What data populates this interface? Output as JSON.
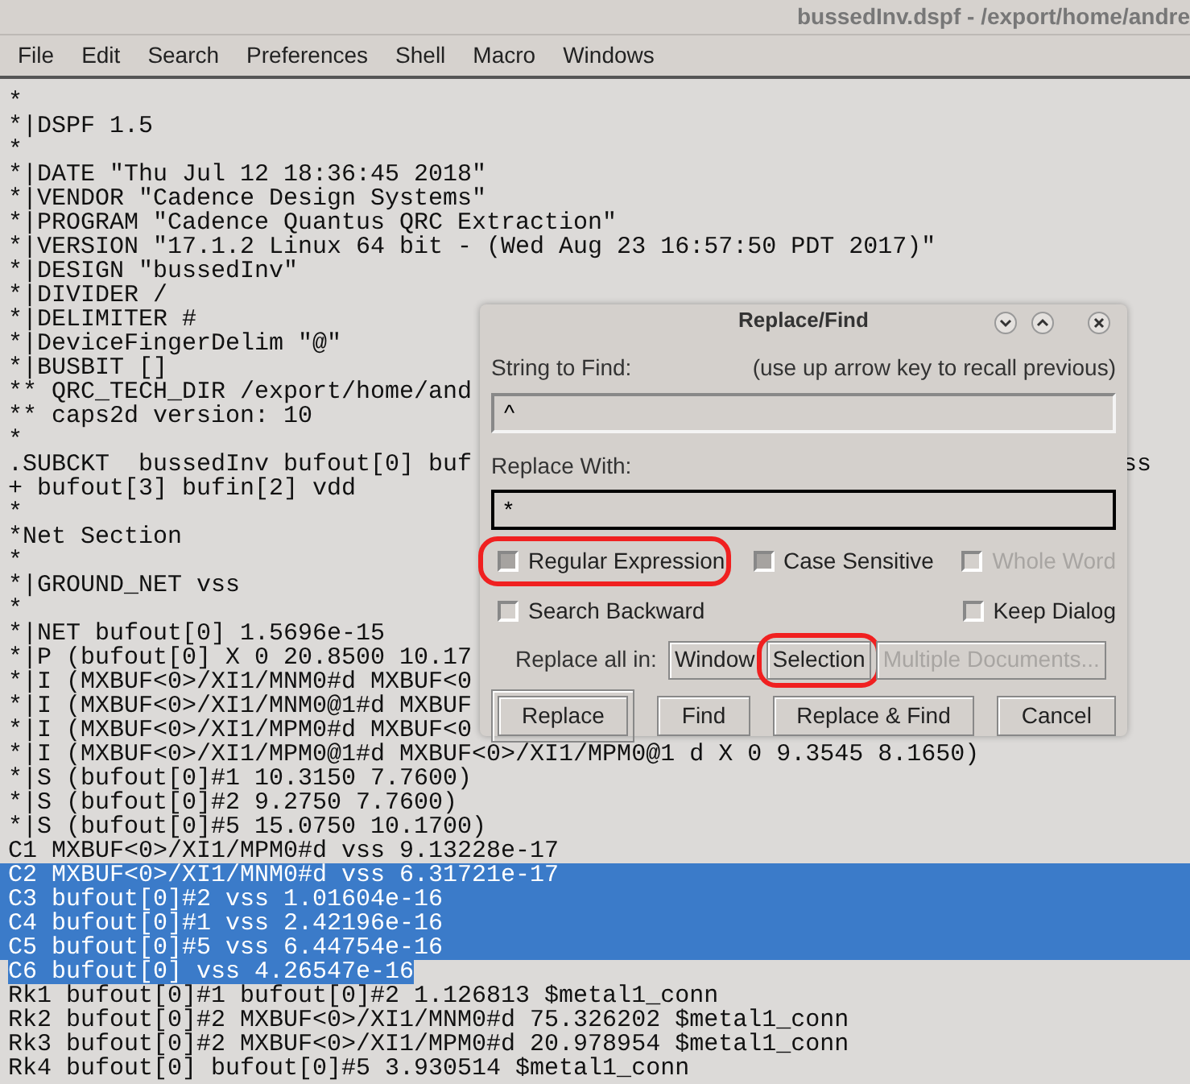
{
  "window": {
    "title": "bussedInv.dspf - /export/home/andre"
  },
  "menu": [
    "File",
    "Edit",
    "Search",
    "Preferences",
    "Shell",
    "Macro",
    "Windows"
  ],
  "editor": {
    "lines": [
      {
        "text": "*",
        "selected": false
      },
      {
        "text": "*|DSPF 1.5",
        "selected": false
      },
      {
        "text": "*",
        "selected": false
      },
      {
        "text": "*|DATE \"Thu Jul 12 18:36:45 2018\"",
        "selected": false
      },
      {
        "text": "*|VENDOR \"Cadence Design Systems\"",
        "selected": false
      },
      {
        "text": "*|PROGRAM \"Cadence Quantus QRC Extraction\"",
        "selected": false
      },
      {
        "text": "*|VERSION \"17.1.2 Linux 64 bit - (Wed Aug 23 16:57:50 PDT 2017)\"",
        "selected": false
      },
      {
        "text": "*|DESIGN \"bussedInv\"",
        "selected": false
      },
      {
        "text": "*|DIVIDER /",
        "selected": false
      },
      {
        "text": "*|DELIMITER #",
        "selected": false
      },
      {
        "text": "*|DeviceFingerDelim \"@\"",
        "selected": false
      },
      {
        "text": "*|BUSBIT []",
        "selected": false
      },
      {
        "text": "** QRC_TECH_DIR /export/home/and",
        "selected": false
      },
      {
        "text": "** caps2d version: 10",
        "selected": false
      },
      {
        "text": "*",
        "selected": false
      },
      {
        "text": ".SUBCKT  bussedInv bufout[0] buf",
        "tail": "ss",
        "selected": false
      },
      {
        "text": "+ bufout[3] bufin[2] vdd",
        "selected": false
      },
      {
        "text": "*",
        "selected": false
      },
      {
        "text": "*Net Section",
        "selected": false
      },
      {
        "text": "*",
        "selected": false
      },
      {
        "text": "*|GROUND_NET vss",
        "selected": false
      },
      {
        "text": "*",
        "selected": false
      },
      {
        "text": "*|NET bufout[0] 1.5696e-15",
        "selected": false
      },
      {
        "text": "*|P (bufout[0] X 0 20.8500 10.17",
        "selected": false
      },
      {
        "text": "*|I (MXBUF<0>/XI1/MNM0#d MXBUF<0",
        "selected": false
      },
      {
        "text": "*|I (MXBUF<0>/XI1/MNM0@1#d MXBUF",
        "selected": false
      },
      {
        "text": "*|I (MXBUF<0>/XI1/MPM0#d MXBUF<0",
        "selected": false
      },
      {
        "text": "*|I (MXBUF<0>/XI1/MPM0@1#d MXBUF<0>/XI1/MPM0@1 d X 0 9.3545 8.1650)",
        "selected": false
      },
      {
        "text": "*|S (bufout[0]#1 10.3150 7.7600)",
        "selected": false
      },
      {
        "text": "*|S (bufout[0]#2 9.2750 7.7600)",
        "selected": false
      },
      {
        "text": "*|S (bufout[0]#5 15.0750 10.1700)",
        "selected": false
      },
      {
        "text": "C1 MXBUF<0>/XI1/MPM0#d vss 9.13228e-17",
        "selected": false
      },
      {
        "text": "C2 MXBUF<0>/XI1/MNM0#d vss 6.31721e-17",
        "selected": true
      },
      {
        "text": "C3 bufout[0]#2 vss 1.01604e-16",
        "selected": true
      },
      {
        "text": "C4 bufout[0]#1 vss 2.42196e-16",
        "selected": true
      },
      {
        "text": "C5 bufout[0]#5 vss 6.44754e-16",
        "selected": true
      },
      {
        "text": "C6 bufout[0] vss 4.26547e-16",
        "selected": true
      },
      {
        "text": "Rk1 bufout[0]#1 bufout[0]#2 1.126813 $metal1_conn",
        "selected": false
      },
      {
        "text": "Rk2 bufout[0]#2 MXBUF<0>/XI1/MNM0#d 75.326202 $metal1_conn",
        "selected": false
      },
      {
        "text": "Rk3 bufout[0]#2 MXBUF<0>/XI1/MPM0#d 20.978954 $metal1_conn",
        "selected": false
      },
      {
        "text": "Rk4 bufout[0] bufout[0]#5 3.930514 $metal1_conn",
        "selected": false
      }
    ]
  },
  "dialog": {
    "title": "Replace/Find",
    "find_label": "String to Find:",
    "find_hint": "(use up arrow key to recall previous)",
    "find_value": "^",
    "replace_label": "Replace With:",
    "replace_value": "*",
    "options": [
      {
        "label": "Regular Expression",
        "checked": true,
        "disabled": false,
        "highlighted": true
      },
      {
        "label": "Case Sensitive",
        "checked": true,
        "disabled": false,
        "highlighted": false
      },
      {
        "label": "Whole Word",
        "checked": false,
        "disabled": true,
        "highlighted": false
      },
      {
        "label": "Search Backward",
        "checked": false,
        "disabled": false,
        "highlighted": false
      },
      {
        "label": "Keep Dialog",
        "checked": false,
        "disabled": false,
        "highlighted": false
      }
    ],
    "replace_all_label": "Replace all in:",
    "scope_buttons": [
      {
        "label": "Window",
        "disabled": false,
        "highlighted": false
      },
      {
        "label": "Selection",
        "disabled": false,
        "highlighted": true
      },
      {
        "label": "Multiple Documents...",
        "disabled": true,
        "highlighted": false
      }
    ],
    "buttons": [
      {
        "label": "Replace",
        "default": true
      },
      {
        "label": "Find",
        "default": false
      },
      {
        "label": "Replace & Find",
        "default": false
      },
      {
        "label": "Cancel",
        "default": false
      }
    ]
  }
}
